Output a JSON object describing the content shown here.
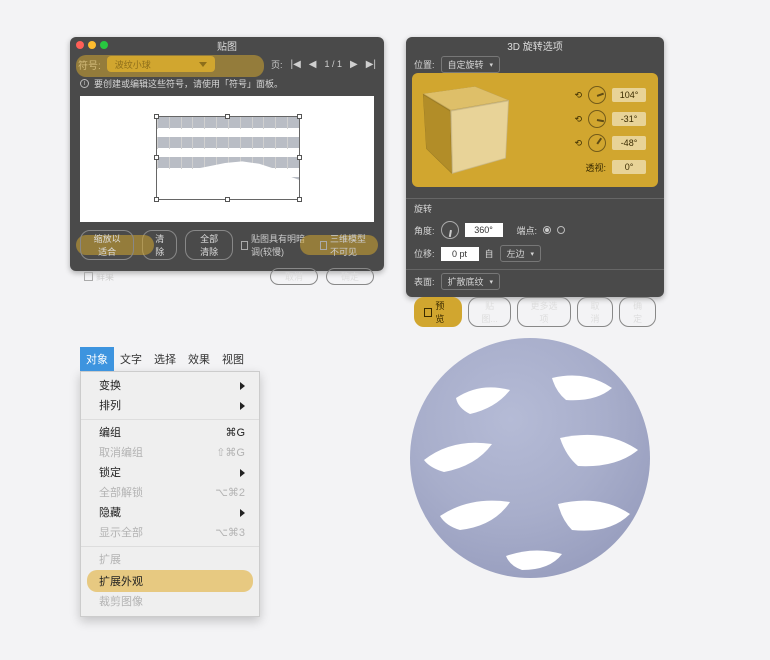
{
  "panelA": {
    "title": "贴图",
    "symbolLabel": "符号:",
    "symbolDropdown": "波纹小球",
    "pageLabel": "页:",
    "pageValue": "1 / 1",
    "hint": "要创建或编辑这些符号，请使用「符号」面板。",
    "btnFit": "缩放以适合",
    "btnClear": "清除",
    "btnClearAll": "全部清除",
    "chkShade": "贴图具有明暗调(较慢)",
    "chkInvisible": "三维模型不可见",
    "chkPreview": "鲜果",
    "btnCancel": "取消",
    "btnOK": "确定"
  },
  "panelB": {
    "title": "3D 旋转选项",
    "posLabel": "位置:",
    "posValue": "自定旋转",
    "rotA": "104°",
    "rotB": "-31°",
    "rotC": "-48°",
    "perspLabel": "透视:",
    "perspVal": "0°",
    "secRotate": "旋转",
    "angleLabel": "角度:",
    "angleVal": "360°",
    "endLabel": "端点:",
    "offsetLabel": "位移:",
    "offsetVal": "0 pt",
    "fromLabel": "自",
    "fromVal": "左边",
    "surfaceLabel": "表面:",
    "surfaceVal": "扩散底纹",
    "chkPreview": "预览",
    "btnMap": "贴图...",
    "btnMore": "更多选项",
    "btnCancel": "取消",
    "btnOK": "确定"
  },
  "panelC": {
    "tabs": [
      "对象",
      "文字",
      "选择",
      "效果",
      "视图"
    ],
    "items": {
      "transform": "变换",
      "arrange": "排列",
      "group": "编组",
      "groupKey": "⌘G",
      "ungroup": "取消编组",
      "ungroupKey": "⇧⌘G",
      "lock": "锁定",
      "unlockAll": "全部解锁",
      "unlockAllKey": "⌥⌘2",
      "hide": "隐藏",
      "showAll": "显示全部",
      "showAllKey": "⌥⌘3",
      "expand": "扩展",
      "expandAppearance": "扩展外观",
      "crop": "裁剪图像"
    }
  }
}
